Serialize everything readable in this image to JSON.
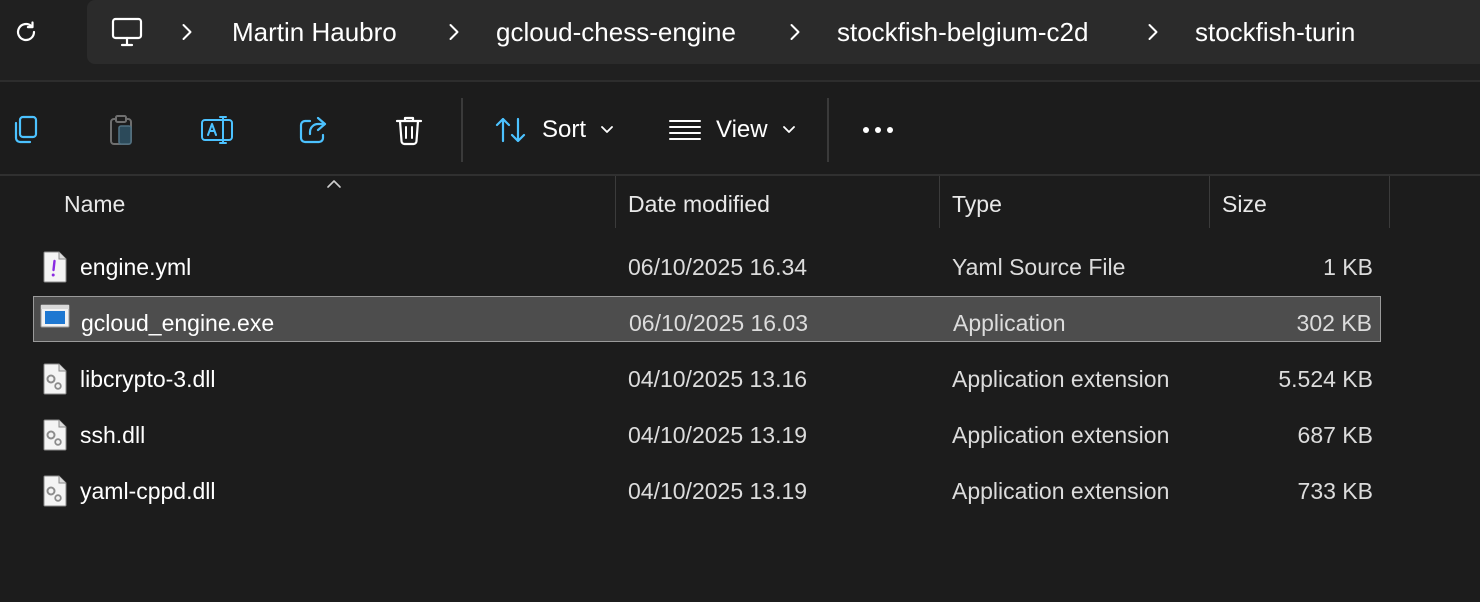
{
  "address_bar": {
    "breadcrumbs": [
      "Martin Haubro",
      "gcloud-chess-engine",
      "stockfish-belgium-c2d",
      "stockfish-turin"
    ],
    "icons": {
      "refresh": "refresh-icon",
      "root": "this-pc-icon",
      "separator": "chevron-right-icon"
    }
  },
  "toolbar": {
    "buttons": [
      "copy-icon",
      "paste-icon",
      "rename-icon",
      "share-icon",
      "delete-icon"
    ],
    "sort_label": "Sort",
    "view_label": "View",
    "more": "more-options-icon"
  },
  "table": {
    "columns": [
      "Name",
      "Date modified",
      "Type",
      "Size"
    ],
    "sort_column": "Name",
    "rows": [
      {
        "name": "engine.yml",
        "date": "06/10/2025 16.34",
        "type": "Yaml Source File",
        "size": "1 KB",
        "icon": "yaml-file-icon",
        "selected": false
      },
      {
        "name": "gcloud_engine.exe",
        "date": "06/10/2025 16.03",
        "type": "Application",
        "size": "302 KB",
        "icon": "application-icon",
        "selected": true
      },
      {
        "name": "libcrypto-3.dll",
        "date": "04/10/2025 13.16",
        "type": "Application extension",
        "size": "5.524 KB",
        "icon": "dll-file-icon",
        "selected": false
      },
      {
        "name": "ssh.dll",
        "date": "04/10/2025 13.19",
        "type": "Application extension",
        "size": "687 KB",
        "icon": "dll-file-icon",
        "selected": false
      },
      {
        "name": "yaml-cppd.dll",
        "date": "04/10/2025 13.19",
        "type": "Application extension",
        "size": "733 KB",
        "icon": "dll-file-icon",
        "selected": false
      }
    ]
  },
  "colors": {
    "background": "#1c1c1c",
    "address_bg": "#2b2b2b",
    "selection": "#4d4d4d",
    "accent": "#4cc2ff"
  }
}
